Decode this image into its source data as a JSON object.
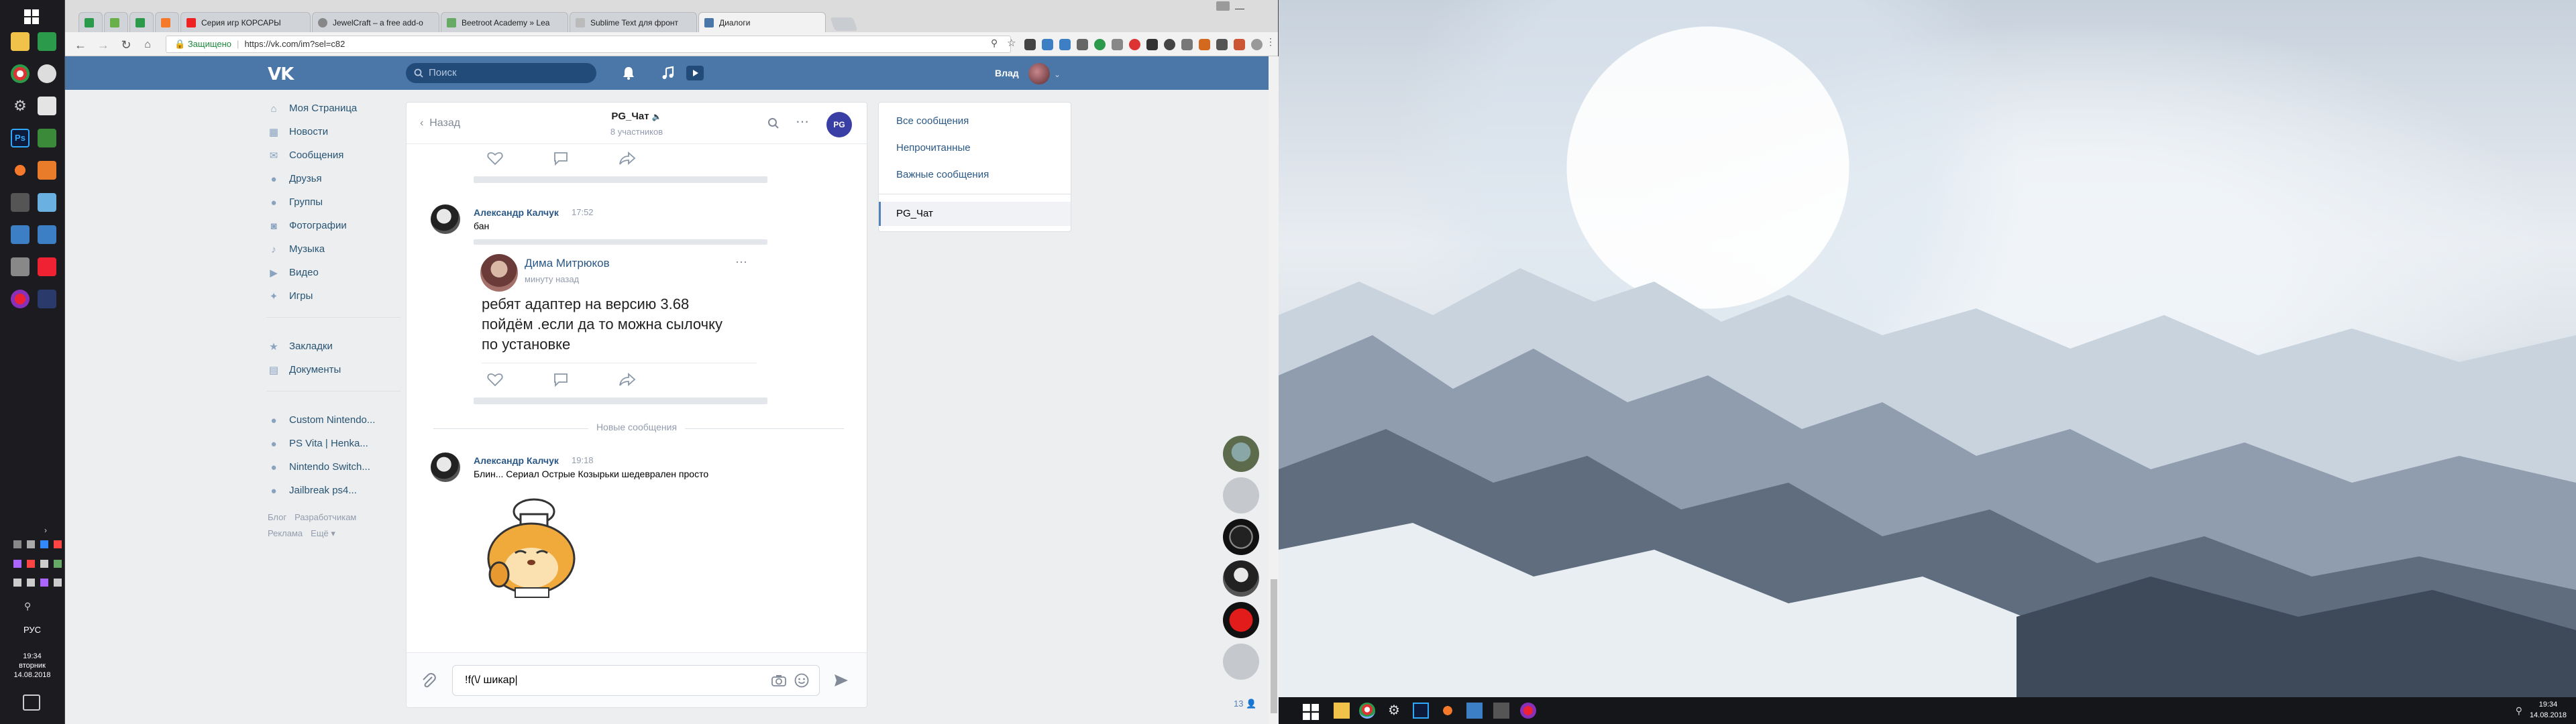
{
  "vertical_taskbar": {
    "language": "РУС",
    "clock": {
      "time": "19:34",
      "day": "вторник",
      "date": "14.08.2018"
    }
  },
  "browser": {
    "tabs": [
      {
        "label": ""
      },
      {
        "label": ""
      },
      {
        "label": ""
      },
      {
        "label": ""
      },
      {
        "label": "Серия игр КОРСАРЫ"
      },
      {
        "label": "JewelCraft – a free add-o"
      },
      {
        "label": "Beetroot Academy » Lea"
      },
      {
        "label": "Sublime Text для фронт"
      },
      {
        "label": "Диалоги"
      }
    ],
    "window_controls": {
      "minimize": "—",
      "maximize": "☐",
      "close": "✕"
    },
    "address": {
      "secure_label": "Защищено",
      "url": "https://vk.com/im?sel=c82"
    }
  },
  "vk": {
    "search_placeholder": "Поиск",
    "user_name": "Влад",
    "menu": [
      {
        "label": "Моя Страница",
        "icon": "home-icon"
      },
      {
        "label": "Новости",
        "icon": "news-icon"
      },
      {
        "label": "Сообщения",
        "icon": "messages-icon"
      },
      {
        "label": "Друзья",
        "icon": "friends-icon"
      },
      {
        "label": "Группы",
        "icon": "groups-icon"
      },
      {
        "label": "Фотографии",
        "icon": "photos-icon"
      },
      {
        "label": "Музыка",
        "icon": "music-icon"
      },
      {
        "label": "Видео",
        "icon": "video-icon"
      },
      {
        "label": "Игры",
        "icon": "games-icon"
      }
    ],
    "menu2": [
      {
        "label": "Закладки",
        "icon": "bookmarks-icon"
      },
      {
        "label": "Документы",
        "icon": "documents-icon"
      }
    ],
    "menu3": [
      {
        "label": "Custom Nintendo...",
        "icon": "community-icon"
      },
      {
        "label": "PS Vita | Henka...",
        "icon": "community-icon"
      },
      {
        "label": "Nintendo Switch...",
        "icon": "community-icon"
      },
      {
        "label": "Jailbreak ps4...",
        "icon": "community-icon"
      }
    ],
    "footer": {
      "blog": "Блог",
      "devs": "Разработчикам",
      "ads": "Реклама",
      "more": "Ещё ▾"
    },
    "chat": {
      "back_label": "Назад",
      "title": "PG_Чат",
      "subtitle": "8 участников",
      "avatar_text": "PG",
      "msg1": {
        "author": "Александр Калчук",
        "time": "17:52",
        "text": "бан",
        "forward": {
          "author": "Дима Митрюков",
          "time": "минуту назад",
          "lines": [
            "ребят адаптер на версию 3.68",
            "пойдём .если да то можна сылочку",
            "по установке"
          ]
        }
      },
      "new_messages_label": "Новые сообщения",
      "msg2": {
        "author": "Александр Калчук",
        "time": "19:18",
        "text": "Блин... Сериал Острые Козырьки шедеврален просто"
      },
      "input_value": "!f(\\/ шикар|"
    },
    "right_nav": [
      {
        "label": "Все сообщения"
      },
      {
        "label": "Непрочитанные"
      },
      {
        "label": "Важные сообщения"
      },
      {
        "label": "PG_Чат"
      }
    ],
    "dock_count": "13 👤"
  },
  "bottom_taskbar": {
    "time": "19:34",
    "date": "14.08.2018"
  },
  "colors": {
    "vk_blue": "#4a76a8",
    "link": "#2a5885",
    "taskbar": "#1b1b20"
  }
}
